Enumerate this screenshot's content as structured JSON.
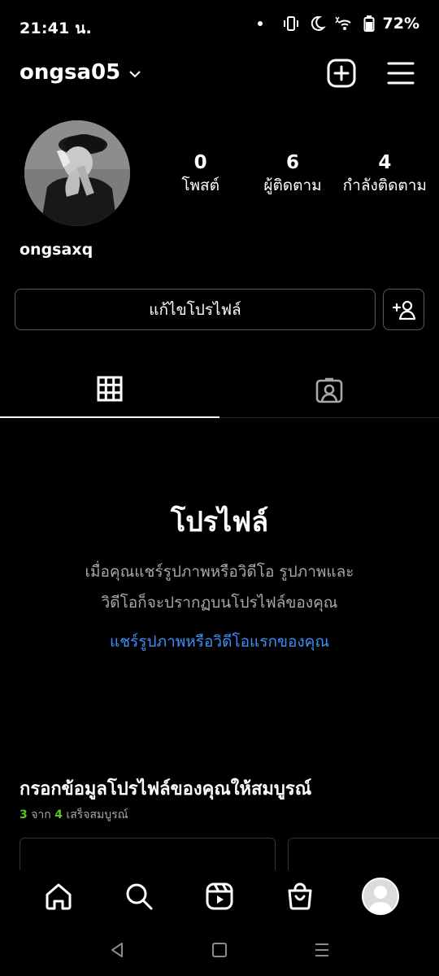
{
  "status_bar": {
    "time": "21:41 น.",
    "battery": "72%"
  },
  "header": {
    "username": "ongsa05"
  },
  "profile": {
    "display_name": "ongsaxq",
    "stats": [
      {
        "value": "0",
        "label": "โพสต์"
      },
      {
        "value": "6",
        "label": "ผู้ติดตาม"
      },
      {
        "value": "4",
        "label": "กำลังติดตาม"
      }
    ],
    "edit_button": "แก้ไขโปรไฟล์"
  },
  "empty_state": {
    "title": "โปรไฟล์",
    "description": "เมื่อคุณแชร์รูปภาพหรือวิดีโอ รูปภาพและวิดีโอก็จะปรากฏบนโปรไฟล์ของคุณ",
    "link": "แชร์รูปภาพหรือวิดีโอแรกของคุณ"
  },
  "complete_profile": {
    "title": "กรอกข้อมูลโปรไฟล์ของคุณให้สมบูรณ์",
    "done": "3",
    "of_label": "จาก",
    "total": "4",
    "done_label": "เสร็จสมบูรณ์"
  },
  "colors": {
    "accent_link": "#3b8ff6",
    "progress_green": "#58c322",
    "background": "#000000"
  },
  "icons": [
    "chevron-down-icon",
    "plus-square-icon",
    "menu-icon",
    "add-person-icon",
    "grid-icon",
    "tagged-icon",
    "home-icon",
    "search-icon",
    "reels-icon",
    "shop-icon",
    "profile-avatar"
  ]
}
